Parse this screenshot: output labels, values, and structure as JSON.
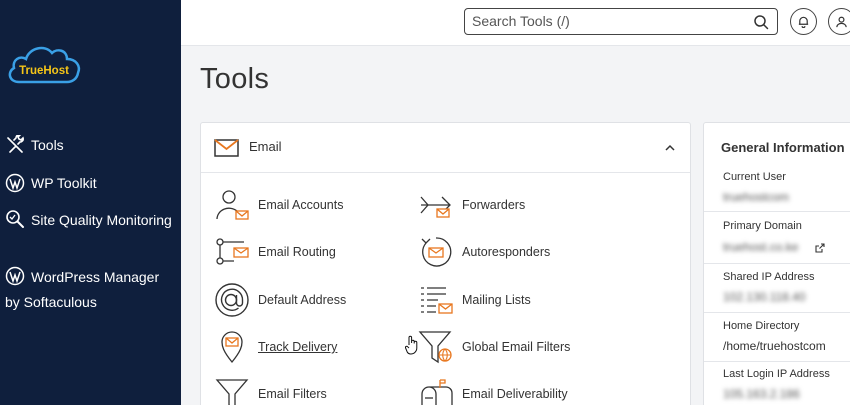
{
  "brand": {
    "logo_text": "TrueHost"
  },
  "sidebar": {
    "items": [
      {
        "label": "Tools",
        "icon": "tools-icon"
      },
      {
        "label": "WP Toolkit",
        "icon": "wordpress-icon"
      },
      {
        "label": "Site Quality Monitoring",
        "icon": "search-quality-icon"
      },
      {
        "label": "WordPress Manager by Softaculous",
        "icon": "wordpress-icon"
      }
    ]
  },
  "header": {
    "search_placeholder": "Search Tools (/)",
    "notifications_icon": "bell-icon",
    "user_icon": "user-icon"
  },
  "page": {
    "title": "Tools"
  },
  "email_section": {
    "title": "Email",
    "tools": [
      {
        "label": "Email Accounts",
        "icon": "email-accounts-icon"
      },
      {
        "label": "Forwarders",
        "icon": "forwarders-icon"
      },
      {
        "label": "Email Routing",
        "icon": "email-routing-icon"
      },
      {
        "label": "Autoresponders",
        "icon": "autoresponders-icon"
      },
      {
        "label": "Default Address",
        "icon": "at-sign-icon"
      },
      {
        "label": "Mailing Lists",
        "icon": "mailing-lists-icon"
      },
      {
        "label": "Track Delivery",
        "icon": "track-delivery-icon"
      },
      {
        "label": "Global Email Filters",
        "icon": "global-filter-icon"
      },
      {
        "label": "Email Filters",
        "icon": "filter-icon"
      },
      {
        "label": "Email Deliverability",
        "icon": "mailbox-icon"
      }
    ]
  },
  "general_info": {
    "title": "General Information",
    "rows": [
      {
        "label": "Current User",
        "value": "truehostcom"
      },
      {
        "label": "Primary Domain",
        "value": "truehost.co.ke"
      },
      {
        "label": "Shared IP Address",
        "value": "102.130.118.40"
      },
      {
        "label": "Home Directory",
        "value": "/home/truehostcom"
      },
      {
        "label": "Last Login IP Address",
        "value": "105.163.2.186"
      }
    ]
  },
  "colors": {
    "sidebar_bg": "#0f1f3d",
    "accent_orange": "#e8771f",
    "logo_blue": "#3aa0e6",
    "logo_text": "#f5c518"
  }
}
